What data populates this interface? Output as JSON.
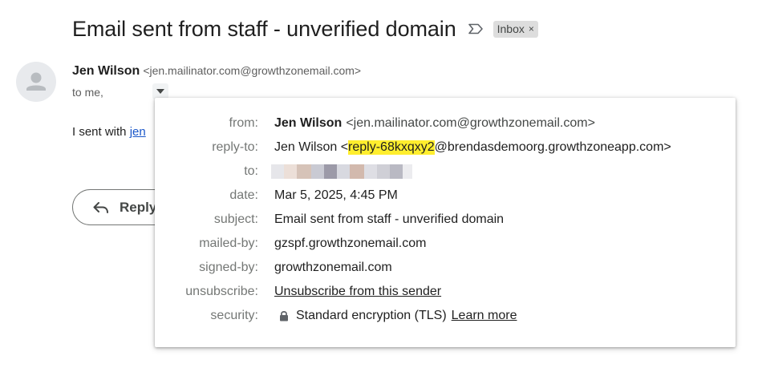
{
  "message": {
    "subject": "Email sent from staff - unverified domain",
    "label": "Inbox",
    "label_close": "×",
    "sender": {
      "name": "Jen Wilson",
      "email": "<jen.mailinator.com@growthzonemail.com>"
    },
    "to_text": "to me,",
    "body_prefix": "I sent with ",
    "body_link": "jen",
    "reply_label": "Reply"
  },
  "details": {
    "from": {
      "label": "from:",
      "name": "Jen Wilson",
      "email": "<jen.mailinator.com@growthzonemail.com>"
    },
    "reply_to": {
      "label": "reply-to:",
      "prefix": "Jen Wilson <",
      "highlight": "reply-68kxqxy2",
      "suffix": "@brendasdemoorg.growthzoneapp.com>"
    },
    "to": {
      "label": "to:"
    },
    "date": {
      "label": "date:",
      "value": "Mar 5, 2025, 4:45 PM"
    },
    "subject": {
      "label": "subject:",
      "value": "Email sent from staff - unverified domain"
    },
    "mailed_by": {
      "label": "mailed-by:",
      "value": "gzspf.growthzonemail.com"
    },
    "signed_by": {
      "label": "signed-by:",
      "value": "growthzonemail.com"
    },
    "unsubscribe": {
      "label": "unsubscribe:",
      "value": "Unsubscribe from this sender"
    },
    "security": {
      "label": "security:",
      "value": "Standard encryption (TLS)",
      "link": "Learn more"
    }
  },
  "colors": {
    "highlight": "#ffee2e",
    "link": "#1a57c9",
    "label_chip": "#dddddd"
  },
  "icons": {
    "important": "important-marker-icon",
    "avatar": "default-avatar-icon",
    "toggle": "caret-down-icon",
    "reply": "reply-arrow-icon",
    "lock": "lock-icon"
  }
}
